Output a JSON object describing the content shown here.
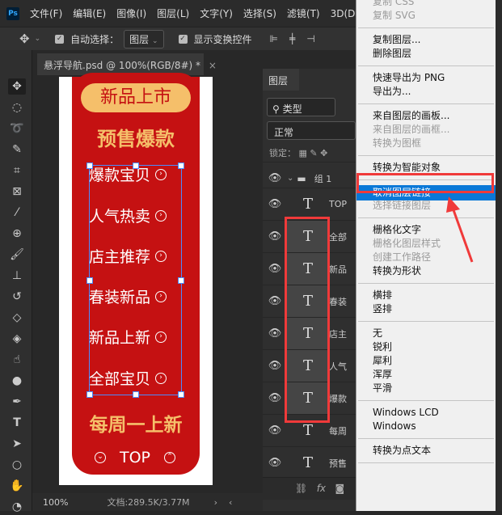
{
  "app": {
    "logo": "Ps",
    "menu": [
      "文件(F)",
      "编辑(E)",
      "图像(I)",
      "图层(L)",
      "文字(Y)",
      "选择(S)",
      "滤镜(T)",
      "3D(D)",
      "视"
    ]
  },
  "options": {
    "move_icon": "move-icon",
    "auto_select_label": "自动选择：",
    "auto_select_value": "图层",
    "show_transform_label": "显示变换控件"
  },
  "document": {
    "tab_title": "悬浮导航.psd @ 100%(RGB/8#) *",
    "close": "×"
  },
  "canvas": {
    "badge": "新品上市",
    "headline": "预售爆款",
    "nav_items": [
      "爆款宝贝",
      "人气热卖",
      "店主推荐",
      "春装新品",
      "新品上新",
      "全部宝贝"
    ],
    "footer": "每周一上新",
    "top_label": "TOP",
    "colors": {
      "red": "#c51112",
      "gold": "#f5bf6a"
    }
  },
  "status": {
    "zoom": "100%",
    "doc_info": "文档:289.5K/3.77M"
  },
  "layers": {
    "tab": "图层",
    "filter": "类型",
    "blend": "正常",
    "lock_label": "锁定：",
    "group": "组 1",
    "items": [
      "TOP",
      "全部",
      "新品",
      "春装",
      "店主",
      "人气",
      "爆款",
      "每周",
      "预售"
    ]
  },
  "context_menu": {
    "items": [
      {
        "label": "复制 CSS",
        "disabled": true
      },
      {
        "label": "复制 SVG",
        "disabled": true
      },
      {
        "sep": true
      },
      {
        "label": "复制图层..."
      },
      {
        "label": "删除图层"
      },
      {
        "sep": true
      },
      {
        "label": "快速导出为 PNG"
      },
      {
        "label": "导出为..."
      },
      {
        "sep": true
      },
      {
        "label": "来自图层的画板..."
      },
      {
        "label": "来自图层的画框...",
        "disabled": true
      },
      {
        "label": "转换为图框",
        "disabled": true
      },
      {
        "sep": true
      },
      {
        "label": "转换为智能对象"
      },
      {
        "sep": true
      },
      {
        "label": "取消图层链接",
        "highlighted": true
      },
      {
        "label": "选择链接图层",
        "disabled": true
      },
      {
        "sep": true
      },
      {
        "label": "栅格化文字"
      },
      {
        "label": "栅格化图层样式",
        "disabled": true
      },
      {
        "label": "创建工作路径",
        "disabled": true
      },
      {
        "label": "转换为形状"
      },
      {
        "sep": true
      },
      {
        "label": "横排"
      },
      {
        "label": "竖排"
      },
      {
        "sep": true
      },
      {
        "label": "无"
      },
      {
        "label": "锐利"
      },
      {
        "label": "犀利"
      },
      {
        "label": "浑厚"
      },
      {
        "label": "平滑"
      },
      {
        "sep": true
      },
      {
        "label": "Windows LCD"
      },
      {
        "label": "Windows"
      },
      {
        "sep": true
      },
      {
        "label": "转换为点文本"
      },
      {
        "sep": true
      }
    ]
  },
  "annotation_color": "#f03a3a"
}
